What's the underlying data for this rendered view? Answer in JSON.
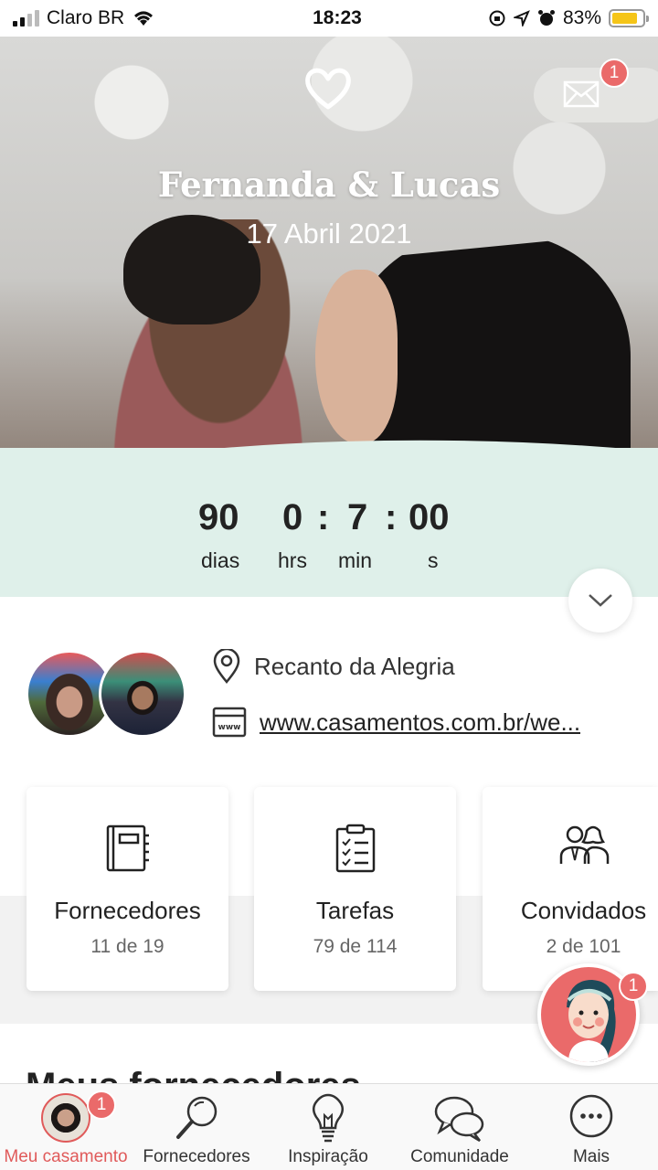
{
  "status_bar": {
    "carrier": "Claro BR",
    "time": "18:23",
    "battery": "83%",
    "battery_level": 0.83
  },
  "hero": {
    "couple": "Fernanda & Lucas",
    "date": "17 Abril 2021",
    "mail_badge": "1"
  },
  "countdown": {
    "days": "90",
    "hours": "0",
    "minutes": "7",
    "seconds": "00",
    "separator": ":",
    "days_label": "dias",
    "hours_label": "hrs",
    "minutes_label": "min",
    "seconds_label": "s"
  },
  "info": {
    "venue": "Recanto da Alegria",
    "website": "www.casamentos.com.br/we..."
  },
  "cards": [
    {
      "title": "Fornecedores",
      "subtitle": "11 de 19"
    },
    {
      "title": "Tarefas",
      "subtitle": "79 de 114"
    },
    {
      "title": "Convidados",
      "subtitle": "2 de 101"
    }
  ],
  "section": {
    "title": "Meus fornecedores"
  },
  "assistant": {
    "badge": "1"
  },
  "tabs": [
    {
      "label": "Meu casamento",
      "badge": "1",
      "icon": "avatar"
    },
    {
      "label": "Fornecedores",
      "icon": "search-icon"
    },
    {
      "label": "Inspiração",
      "icon": "lightbulb-icon"
    },
    {
      "label": "Comunidade",
      "icon": "chat-bubbles-icon"
    },
    {
      "label": "Mais",
      "icon": "more-icon"
    }
  ],
  "colors": {
    "accent": "#e05a5a",
    "mint": "#dff0ea",
    "badge": "#ea6a6a"
  }
}
